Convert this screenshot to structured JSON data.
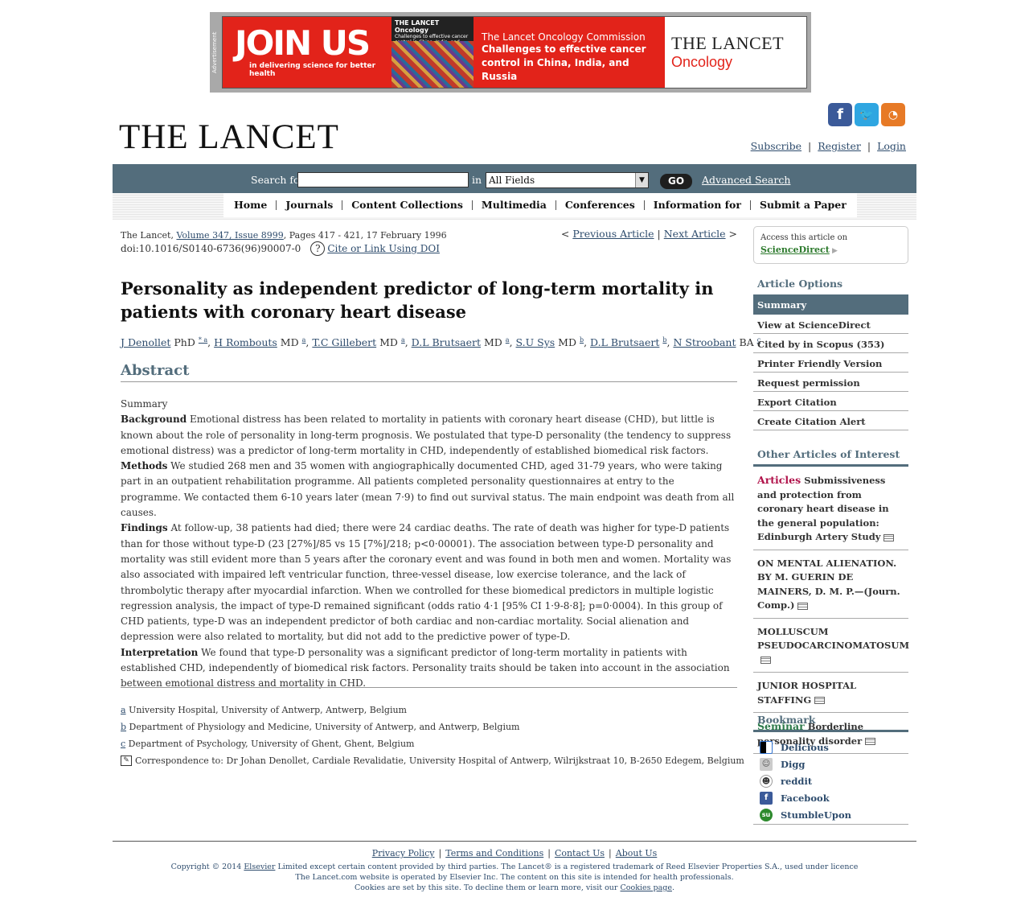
{
  "ad": {
    "label": "Advertisement",
    "join": "JOIN US",
    "join_sub": "in delivering science for better health",
    "cover_title": "THE LANCET Oncology",
    "cover_sub": "Challenges to effective cancer control in China, India, and Russia",
    "commission": "The Lancet Oncology Commission",
    "commission_title": "Challenges to effective cancer control in China, India, and Russia",
    "brand_1": "THE LANCET",
    "brand_2": "Oncology"
  },
  "header": {
    "logo": "THE LANCET",
    "subscribe": "Subscribe",
    "register": "Register",
    "login": "Login",
    "sep": "|"
  },
  "search": {
    "label": "Search for",
    "in": "in",
    "field": "All Fields",
    "go": "GO",
    "advanced": "Advanced Search"
  },
  "nav": [
    "Home",
    "Journals",
    "Content Collections",
    "Multimedia",
    "Conferences",
    "Information for",
    "Submit a Paper"
  ],
  "article": {
    "cite_prefix": "The Lancet,",
    "volume": "Volume 347, Issue 8999",
    "cite_suffix": ", Pages 417 - 421, 17 February 1996",
    "doi": "doi:10.1016/S0140-6736(96)90007-0",
    "doi_link": "Cite or Link Using DOI",
    "prev": "Previous Article",
    "next": "Next Article",
    "title": "Personality as independent predictor of long-term mortality in patients with coronary heart disease",
    "authors": [
      {
        "name": "J Denollet",
        "deg": "PhD",
        "sup": "* a"
      },
      {
        "name": "H Rombouts",
        "deg": "MD",
        "sup": "a"
      },
      {
        "name": "T.C Gillebert",
        "deg": "MD",
        "sup": "a"
      },
      {
        "name": "D.L Brutsaert",
        "deg": "MD",
        "sup": "a"
      },
      {
        "name": "S.U Sys",
        "deg": "MD",
        "sup": "b"
      },
      {
        "name": "D.L Brutsaert",
        "deg": "",
        "sup": "b"
      },
      {
        "name": "N Stroobant",
        "deg": "BA",
        "sup": "c"
      }
    ],
    "abstract_head": "Abstract",
    "summary": "Summary",
    "background_h": "Background",
    "background": "Emotional distress has been related to mortality in patients with coronary heart disease (CHD), but little is known about the role of personality in long-term prognosis. We postulated that type-D personality (the tendency to suppress emotional distress) was a predictor of long-term mortality in CHD, independently of established biomedical risk factors.",
    "methods_h": "Methods",
    "methods": "We studied 268 men and 35 women with angiographically documented CHD, aged 31-79 years, who were taking part in an outpatient rehabilitation programme. All patients completed personality questionnaires at entry to the programme. We contacted them 6-10 years later (mean 7·9) to find out survival status. The main endpoint was death from all causes.",
    "findings_h": "Findings",
    "findings": "At follow-up, 38 patients had died; there were 24 cardiac deaths. The rate of death was higher for type-D patients than for those without type-D (23 [27%]/85 vs 15 [7%]/218; p<0·00001). The association between type-D personality and mortality was still evident more than 5 years after the coronary event and was found in both men and women. Mortality was also associated with impaired left ventricular function, three-vessel disease, low exercise tolerance, and the lack of thrombolytic therapy after myocardial infarction. When we controlled for these biomedical predictors in multiple logistic regression analysis, the impact of type-D remained significant (odds ratio 4·1 [95% CI 1·9-8·8]; p=0·0004). In this group of CHD patients, type-D was an independent predictor of both cardiac and non-cardiac mortality. Social alienation and depression were also related to mortality, but did not add to the predictive power of type-D.",
    "interp_h": "Interpretation",
    "interp": "We found that type-D personality was a significant predictor of long-term mortality in patients with established CHD, independently of biomedical risk factors. Personality traits should be taken into account in the association between emotional distress and mortality in CHD.",
    "affiliations": [
      {
        "mark": "a",
        "text": "University Hospital, University of Antwerp, Antwerp, Belgium"
      },
      {
        "mark": "b",
        "text": "Department of Physiology and Medicine, University of Antwerp, and Antwerp, Belgium"
      },
      {
        "mark": "c",
        "text": "Department of Psychology, University of Ghent, Ghent, Belgium"
      }
    ],
    "correspondence": "Correspondence to: Dr Johan Denollet, Cardiale Revalidatie, University Hospital of Antwerp, Wilrijkstraat 10, B-2650 Edegem, Belgium"
  },
  "sidebar": {
    "access": "Access this article on",
    "sciencedirect": "ScienceDirect",
    "options_head": "Article Options",
    "options": [
      "Summary",
      "View at ScienceDirect",
      "Cited by in Scopus (353)",
      "Printer Friendly Version",
      "Request permission",
      "Export Citation",
      "Create Citation Alert"
    ],
    "other_head": "Other Articles of Interest",
    "other": [
      {
        "kw": "Articles",
        "text": "Submissiveness and protection from coronary heart disease in the general population: Edinburgh Artery Study"
      },
      {
        "kw": "",
        "text": "ON MENTAL ALIENATION. BY M. GUERIN DE MAINERS, D. M. P.—(Journ. Comp.)"
      },
      {
        "kw": "",
        "text": "MOLLUSCUM PSEUDOCARCINOMATOSUM"
      },
      {
        "kw": "",
        "text": "JUNIOR HOSPITAL STAFFING"
      },
      {
        "kw": "Seminar",
        "text": "Borderline personality disorder"
      }
    ],
    "bookmark_head": "Bookmark",
    "bookmarks": [
      "Delicious",
      "Digg",
      "reddit",
      "Facebook",
      "StumbleUpon"
    ]
  },
  "footer": {
    "links": [
      "Privacy Policy",
      "Terms and Conditions",
      "Contact Us",
      "About Us"
    ],
    "copy_pre": "Copyright © 2014",
    "elsevier": "Elsevier",
    "copy_post": "Limited except certain content provided by third parties. The Lancet® is a registered trademark of Reed Elsevier Properties S.A., used under licence",
    "line2": "The Lancet.com website is operated by Elsevier Inc. The content on this site is intended for health professionals.",
    "line3_pre": "Cookies are set by this site. To decline them or learn more, visit our",
    "cookies": "Cookies page",
    "line3_post": "."
  },
  "colors": {
    "bar": "#536d7c",
    "link": "#2e4c6d",
    "ad_red": "#e2231a"
  }
}
